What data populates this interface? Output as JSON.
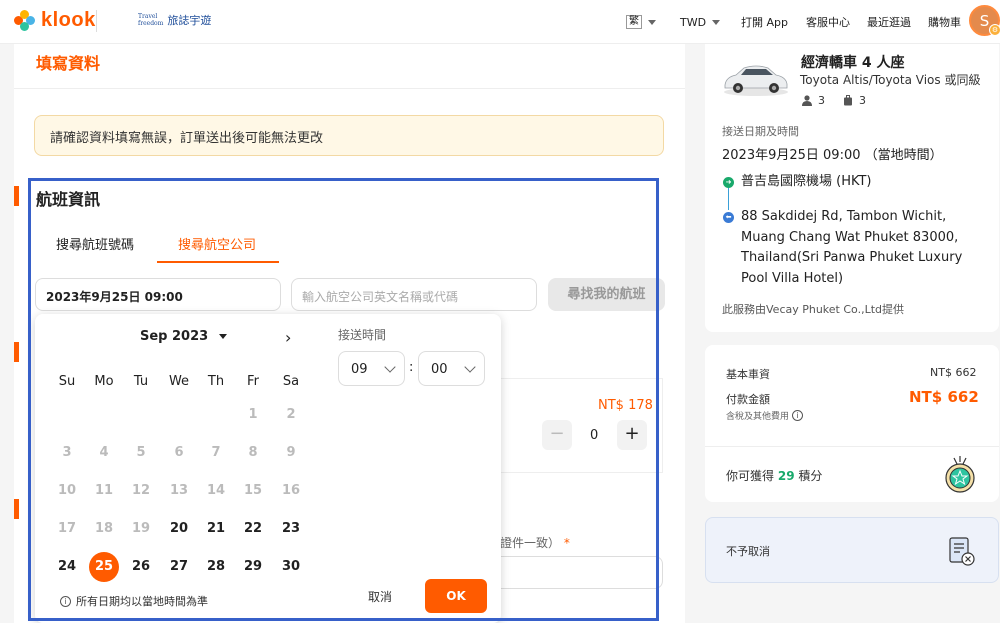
{
  "header": {
    "logo_text": "klook",
    "partner_mark": "Travel\nfreedom",
    "partner_text": "旅誌宇遊",
    "lang_label": "繁",
    "currency_label": "TWD",
    "open_app": "打開 App",
    "customer_service": "客服中心",
    "recent": "最近逛過",
    "cart": "購物車",
    "avatar_letter": "S"
  },
  "form": {
    "title": "填寫資料",
    "notice": "請確認資料填寫無誤，訂單送出後可能無法更改",
    "flight_title": "航班資訊",
    "tabs": [
      "搜尋航班號碼",
      "搜尋航空公司"
    ],
    "date_value": "2023年9月25日 09:00",
    "airline_placeholder": "輸入航空公司英文名稱或代碼",
    "find_button": "尋找我的航班",
    "extra_price": "NT$ 178",
    "stepper_minus": "−",
    "stepper_value": "0",
    "stepper_plus": "+",
    "required_text": "證件一致）",
    "required_star": "*"
  },
  "picker": {
    "month": "Sep 2023",
    "next_label": "›",
    "weekdays": [
      "Su",
      "Mo",
      "Tu",
      "We",
      "Th",
      "Fr",
      "Sa"
    ],
    "weeks": [
      [
        "",
        "",
        "",
        "",
        "",
        "1",
        "2"
      ],
      [
        "3",
        "4",
        "5",
        "6",
        "7",
        "8",
        "9"
      ],
      [
        "10",
        "11",
        "12",
        "13",
        "14",
        "15",
        "16"
      ],
      [
        "17",
        "18",
        "19",
        "20",
        "21",
        "22",
        "23"
      ],
      [
        "24",
        "25",
        "26",
        "27",
        "28",
        "29",
        "30"
      ]
    ],
    "selected_day": "25",
    "first_available_day": 20,
    "time_label": "接送時間",
    "hour": "09",
    "minute": "00",
    "colon": ":",
    "note": "所有日期均以當地時間為準",
    "cancel": "取消",
    "ok": "OK"
  },
  "summary": {
    "car_title": "經濟轎車 4 人座",
    "car_subtitle": "Toyota Altis/Toyota Vios 或同級",
    "passengers": "3",
    "luggage": "3",
    "pickup_label": "接送日期及時間",
    "pickup_time": "2023年9月25日 09:00 （當地時間）",
    "from": "普吉島國際機場 (HKT)",
    "to": "88 Sakdidej Rd, Tambon Wichit, Muang Chang Wat Phuket 83000, Thailand(Sri Panwa Phuket Luxury Pool Villa Hotel)",
    "provider": "此服務由Vecay Phuket Co.,Ltd提供"
  },
  "pricing": {
    "base_label": "基本車資",
    "base_value": "NT$ 662",
    "total_label": "付款金額",
    "total_value": "NT$ 662",
    "tax_note": "含稅及其他費用",
    "points_prefix": "你可獲得",
    "points_value": "29",
    "points_suffix": "積分"
  },
  "cancellation": {
    "text": "不予取消"
  },
  "colors": {
    "accent": "#ff5b00",
    "highlight": "#3760c9",
    "points": "#19a96b"
  }
}
